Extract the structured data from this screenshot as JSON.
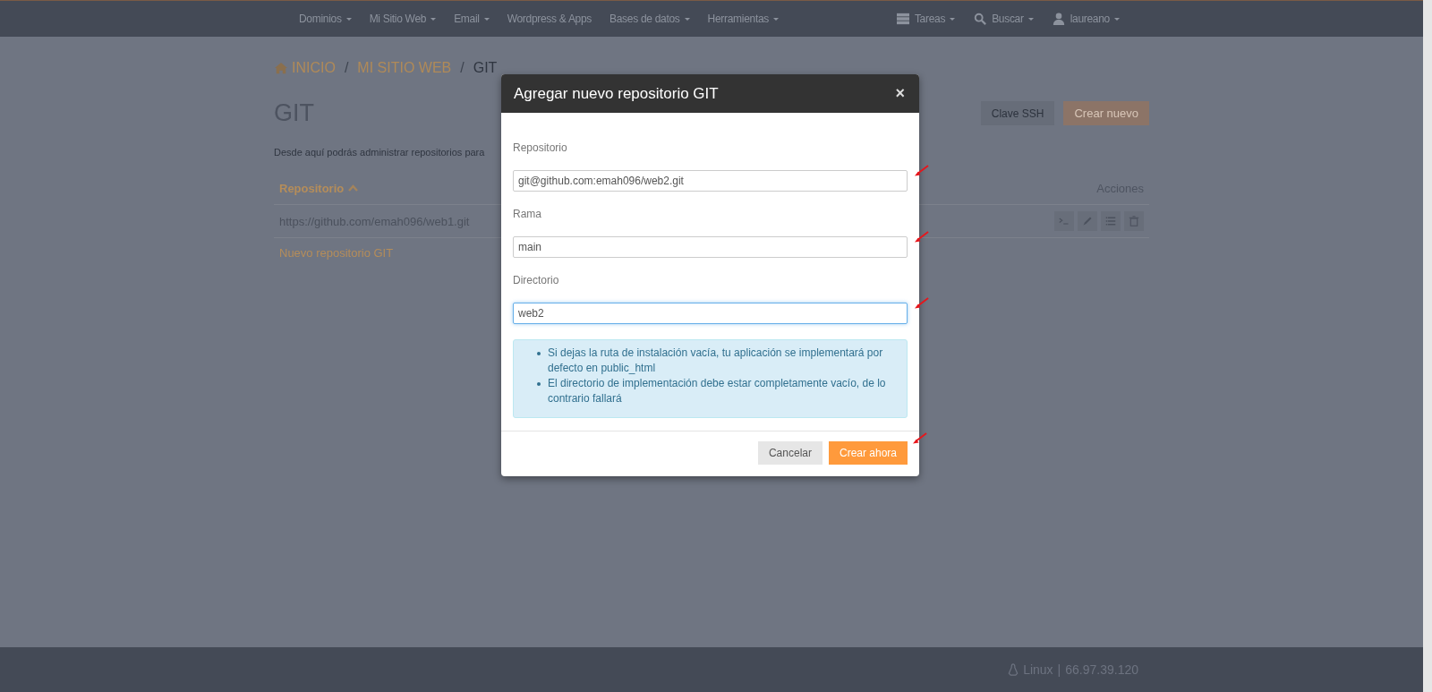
{
  "navbar": {
    "menu": [
      {
        "label": "Dominios",
        "dropdown": true
      },
      {
        "label": "Mi Sitio Web",
        "dropdown": true
      },
      {
        "label": "Email",
        "dropdown": true
      },
      {
        "label": "Wordpress & Apps",
        "dropdown": false
      },
      {
        "label": "Bases de datos",
        "dropdown": true
      },
      {
        "label": "Herramientas",
        "dropdown": true
      }
    ],
    "right": [
      {
        "kind": "tasks",
        "label": "Tareas",
        "dropdown": true
      },
      {
        "kind": "search",
        "label": "Buscar",
        "dropdown": true
      },
      {
        "kind": "user",
        "label": "laureano",
        "dropdown": true
      }
    ]
  },
  "breadcrumb": {
    "separator": "/",
    "items": [
      {
        "kind": "home",
        "label": "INICIO",
        "link": true
      },
      {
        "kind": "text",
        "label": "MI SITIO WEB",
        "link": true
      },
      {
        "kind": "text",
        "label": "GIT",
        "link": false
      }
    ]
  },
  "page": {
    "title": "GIT",
    "description": "Desde aquí podrás administrar repositorios para",
    "buttons": [
      {
        "label": "Clave SSH",
        "kind": "default"
      },
      {
        "label": "Crear nuevo",
        "kind": "primary"
      }
    ]
  },
  "table": {
    "columns": [
      {
        "label": "Repositorio",
        "sorted": true
      },
      {
        "label": "Acciones",
        "sorted": false
      }
    ],
    "rows": [
      {
        "repository": "https://github.com/emah096/web1.git",
        "actions": [
          {
            "kind": "terminal"
          },
          {
            "kind": "edit"
          },
          {
            "kind": "list"
          },
          {
            "kind": "delete"
          }
        ]
      }
    ],
    "add_link": "Nuevo repositorio GIT"
  },
  "modal": {
    "title": "Agregar nuevo repositorio GIT",
    "close": "×",
    "fields": [
      {
        "label": "Repositorio",
        "value": "git@github.com:emah096/web2.git",
        "focused": false,
        "marked": true
      },
      {
        "label": "Rama",
        "value": "main",
        "focused": false,
        "marked": true
      },
      {
        "label": "Directorio",
        "value": "web2",
        "focused": true,
        "marked": true
      }
    ],
    "notes": [
      "Si dejas la ruta de instalación vacía, tu aplicación se implementará por defecto en public_html",
      "El directorio de implementación debe estar completamente vacío, de lo contrario fallará"
    ],
    "buttons": [
      {
        "label": "Cancelar",
        "kind": "default"
      },
      {
        "label": "Crear ahora",
        "kind": "primary",
        "marked": true
      }
    ]
  },
  "footer": {
    "os": "Linux",
    "separator": "|",
    "ip": "66.97.39.120"
  }
}
